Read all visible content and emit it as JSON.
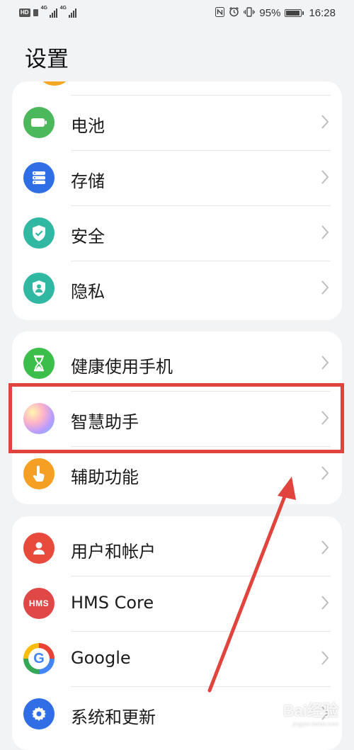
{
  "status_bar": {
    "sim_badge": "HD",
    "network1": "4G",
    "network2": "4G",
    "battery_percent": "95%",
    "battery_level": 0.95,
    "time": "16:28",
    "icons": [
      "nfc-icon",
      "alarm-icon",
      "vibrate-icon",
      "battery-icon"
    ]
  },
  "title": "设置",
  "groups": [
    {
      "items": [
        {
          "label": "电池",
          "icon": "battery-icon",
          "color": "#4cb85c"
        },
        {
          "label": "存储",
          "icon": "storage-icon",
          "color": "#2f6ee5"
        },
        {
          "label": "安全",
          "icon": "shield-icon",
          "color": "#31b8a2"
        },
        {
          "label": "隐私",
          "icon": "privacy-icon",
          "color": "#31b8a2"
        }
      ]
    },
    {
      "items": [
        {
          "label": "健康使用手机",
          "icon": "hourglass-icon",
          "color": "#3cbf4a"
        },
        {
          "label": "智慧助手",
          "icon": "assistant-orb-icon",
          "color": "#a78bfa"
        },
        {
          "label": "辅助功能",
          "icon": "hand-icon",
          "color": "#f5a022"
        }
      ]
    },
    {
      "items": [
        {
          "label": "用户和帐户",
          "icon": "user-icon",
          "color": "#e84a3c"
        },
        {
          "label": "HMS Core",
          "icon": "hms-icon",
          "color": "#e04848",
          "icon_text": "HMS"
        },
        {
          "label": "Google",
          "icon": "google-icon",
          "color": "#ffffff",
          "icon_text": "G"
        },
        {
          "label": "系统和更新",
          "icon": "gear-icon",
          "color": "#2f6ee5"
        }
      ]
    }
  ],
  "highlight_color": "#e0443c",
  "watermark": {
    "text": "Bai经验",
    "sub": "jingyan.baidu.com"
  }
}
